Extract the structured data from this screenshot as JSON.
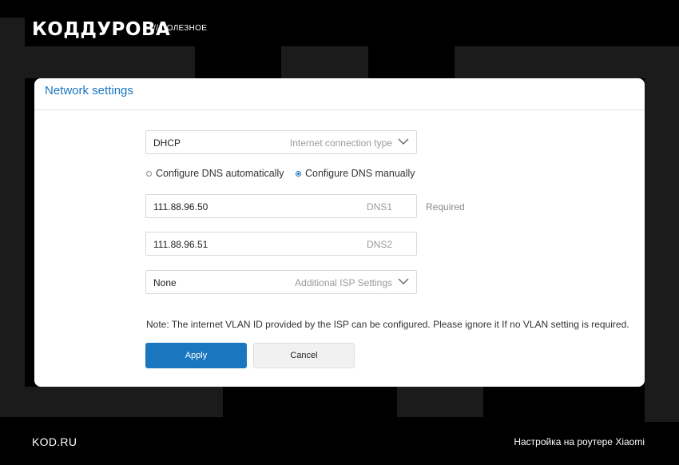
{
  "branding": {
    "logo": "КОДДУРОВА",
    "tag": "// ПОЛЕЗНОЕ"
  },
  "card": {
    "title": "Network settings",
    "connection": {
      "value": "DHCP",
      "hint": "Internet connection type"
    },
    "dns_mode": {
      "auto_label": "Configure DNS automatically",
      "manual_label": "Configure DNS manually",
      "selected": "manual"
    },
    "dns1": {
      "value": "111.88.96.50",
      "hint": "DNS1",
      "required": "Required"
    },
    "dns2": {
      "value": "111.88.96.51",
      "hint": "DNS2"
    },
    "isp": {
      "value": "None",
      "hint": "Additional ISP Settings"
    },
    "note": "Note: The internet VLAN ID provided by the ISP can be configured. Please ignore it If no VLAN setting is required.",
    "apply_label": "Apply",
    "cancel_label": "Cancel"
  },
  "footer": {
    "left": "KOD.RU",
    "right": "Настройка на роутере Xiaomi"
  },
  "colors": {
    "accent": "#1b76c0",
    "background": "#000000",
    "block": "#1b1b1b"
  }
}
